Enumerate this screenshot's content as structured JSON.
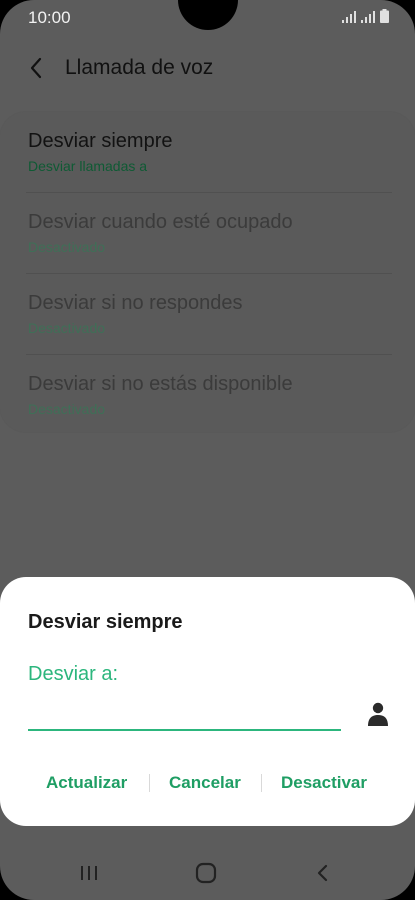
{
  "status_bar": {
    "time": "10:00"
  },
  "header": {
    "title": "Llamada de voz"
  },
  "forward_options": [
    {
      "title": "Desviar siempre",
      "subtitle": "Desviar llamadas a"
    },
    {
      "title": "Desviar cuando esté ocupado",
      "subtitle": "Desactivado"
    },
    {
      "title": "Desviar si no respondes",
      "subtitle": "Desactivado"
    },
    {
      "title": "Desviar si no estás disponible",
      "subtitle": "Desactivado"
    }
  ],
  "dialog": {
    "title": "Desviar siempre",
    "field_label": "Desviar a:",
    "field_value": "",
    "actions": {
      "update": "Actualizar",
      "cancel": "Cancelar",
      "deactivate": "Desactivar"
    }
  },
  "colors": {
    "accent": "#2cb67d",
    "action_text": "#1f9e64",
    "dim_overlay": "#5c5c5c",
    "dialog_bg": "#ffffff"
  },
  "icons": {
    "back": "chevron-left-icon",
    "contact": "person-icon",
    "nav_recents": "recent-apps-icon",
    "nav_home": "home-icon",
    "nav_back": "back-icon"
  }
}
